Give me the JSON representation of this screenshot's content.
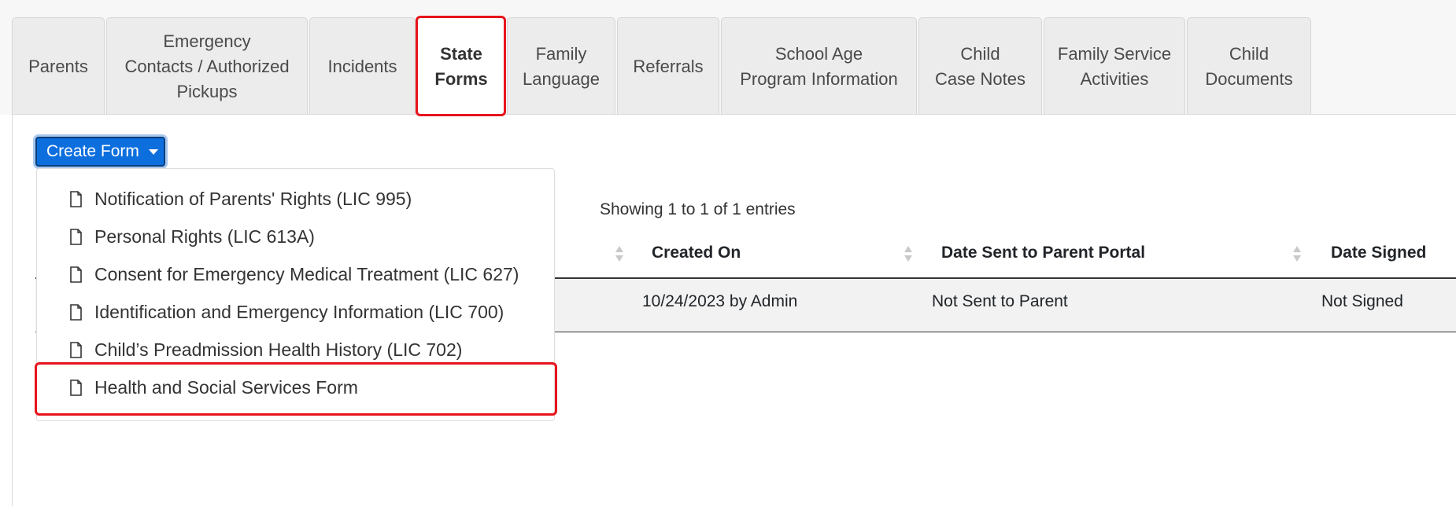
{
  "tabs": [
    {
      "label": "Parents"
    },
    {
      "label": "Emergency\nContacts / Authorized\nPickups"
    },
    {
      "label": "Incidents"
    },
    {
      "label": "State\nForms"
    },
    {
      "label": "Family\nLanguage"
    },
    {
      "label": "Referrals"
    },
    {
      "label": "School Age\nProgram Information"
    },
    {
      "label": "Child\nCase Notes"
    },
    {
      "label": "Family Service\nActivities"
    },
    {
      "label": "Child\nDocuments"
    }
  ],
  "active_tab": "State Forms",
  "create_button": {
    "label": "Create Form"
  },
  "dropdown": {
    "items": [
      {
        "label": "Notification of Parents' Rights (LIC 995)",
        "icon": "file-icon"
      },
      {
        "label": "Personal Rights (LIC 613A)",
        "icon": "file-icon"
      },
      {
        "label": "Consent for Emergency Medical Treatment (LIC 627)",
        "icon": "file-icon"
      },
      {
        "label": "Identification and Emergency Information (LIC 700)",
        "icon": "file-icon"
      },
      {
        "label": "Child’s Preadmission Health History (LIC 702)",
        "icon": "file-icon"
      },
      {
        "label": "Health and Social Services Form",
        "icon": "file-icon"
      }
    ]
  },
  "table": {
    "showing": "Showing 1 to 1 of 1 entries",
    "columns": [
      "Created On",
      "Date Sent to Parent Portal",
      "Date Signed"
    ],
    "rows": [
      [
        "10/24/2023 by Admin",
        "Not Sent to Parent",
        "Not Signed"
      ]
    ]
  },
  "colors": {
    "highlight": "#e8141c",
    "primary": "#0d6fde"
  }
}
